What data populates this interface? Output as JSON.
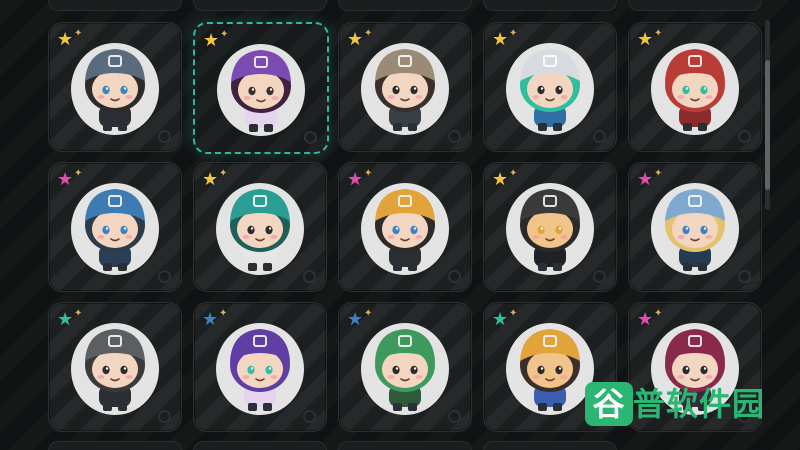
{
  "title": "",
  "grid": {
    "selected_index": 1,
    "slots": [
      {
        "id": "char-1",
        "star_color": "#f2c53a",
        "hat": "#5a6b7d",
        "hair": "#2d2a2a",
        "eyes": "#3b82c4",
        "skin": "#f3d6c1",
        "outfit": "#2b2f33",
        "icon": "helmet-gray"
      },
      {
        "id": "char-2",
        "star_color": "#f2c53a",
        "hat": "#7b4bb3",
        "hair": "#40223f",
        "eyes": "#3a2f2a",
        "skin": "#f3d6c1",
        "outfit": "#e6d3ef",
        "icon": "hood-purple"
      },
      {
        "id": "char-3",
        "star_color": "#f2c53a",
        "hat": "#9b8a75",
        "hair": "#3a2f2a",
        "eyes": "#2d2a2a",
        "skin": "#f3d6c1",
        "outfit": "#3a3f44",
        "icon": "helmet-tan"
      },
      {
        "id": "char-4",
        "star_color": "#f2c53a",
        "hat": "#d7dbe0",
        "hair": "#2fbf9f",
        "eyes": "#2d2a2a",
        "skin": "#f3d6c1",
        "outfit": "#2f6fa3",
        "icon": "helmet-white"
      },
      {
        "id": "char-5",
        "star_color": "#f2c53a",
        "hat": "#b93c36",
        "hair": "#b93c36",
        "eyes": "#2fbf9f",
        "skin": "#f3d6c1",
        "outfit": "#8a2d2a",
        "icon": "helmet-red"
      },
      {
        "id": "char-6",
        "star_color": "#e24bb0",
        "hat": "#3e7bb2",
        "hair": "#2a3b49",
        "eyes": "#3b82c4",
        "skin": "#f3d6c1",
        "outfit": "#2a3f55",
        "icon": "helmet-blue"
      },
      {
        "id": "char-7",
        "star_color": "#f2c53a",
        "hat": "#2a9d94",
        "hair": "#1f5f5a",
        "eyes": "#2d2a2a",
        "skin": "#f3d6c1",
        "outfit": "#e6e6e6",
        "icon": "helmet-teal"
      },
      {
        "id": "char-8",
        "star_color": "#e24bb0",
        "hat": "#e2a43a",
        "hair": "#2d2a2a",
        "eyes": "#3b82c4",
        "skin": "#f3d6c1",
        "outfit": "#2b2f33",
        "icon": "helmet-yellow"
      },
      {
        "id": "char-9",
        "star_color": "#f2c53a",
        "hat": "#3a3a3a",
        "hair": "#2a2a2a",
        "eyes": "#e2a43a",
        "skin": "#f0c48a",
        "outfit": "#1e2225",
        "icon": "helmet-black"
      },
      {
        "id": "char-10",
        "star_color": "#e24bb0",
        "hat": "#7fa9cf",
        "hair": "#e2c36c",
        "eyes": "#3b82c4",
        "skin": "#f3d6c1",
        "outfit": "#243b52",
        "icon": "cap-lightblue"
      },
      {
        "id": "char-11",
        "star_color": "#2fbf9f",
        "hat": "#5b5f61",
        "hair": "#3a3a3a",
        "eyes": "#2d2a2a",
        "skin": "#f3d6c1",
        "outfit": "#2b2f33",
        "icon": "helmet-dark"
      },
      {
        "id": "char-12",
        "star_color": "#3b82c4",
        "hat": "#5f3fa3",
        "hair": "#5f3fa3",
        "eyes": "#2fbf9f",
        "skin": "#f3d6c1",
        "outfit": "#e6d3ef",
        "icon": "hair-purple"
      },
      {
        "id": "char-13",
        "star_color": "#3b82c4",
        "hat": "#3e9a5c",
        "hair": "#3e9a5c",
        "eyes": "#2d2a2a",
        "skin": "#f3d6c1",
        "outfit": "#2e5a3a",
        "icon": "hair-green"
      },
      {
        "id": "char-14",
        "star_color": "#2fbf9f",
        "hat": "#e2a43a",
        "hair": "#3a2f2a",
        "eyes": "#2d2a2a",
        "skin": "#f0c48a",
        "outfit": "#3a5fb0",
        "icon": "cap-yellow"
      },
      {
        "id": "char-15",
        "star_color": "#e24bb0",
        "hat": "#8a2a4a",
        "hair": "#8a2a4a",
        "eyes": "#2d2a2a",
        "skin": "#f3d6c1",
        "outfit": "#3a2a3a",
        "icon": "hood-maroon"
      }
    ]
  },
  "watermark": {
    "first_char": "谷",
    "rest": "普软件园",
    "color_brand": "#2bb673"
  }
}
